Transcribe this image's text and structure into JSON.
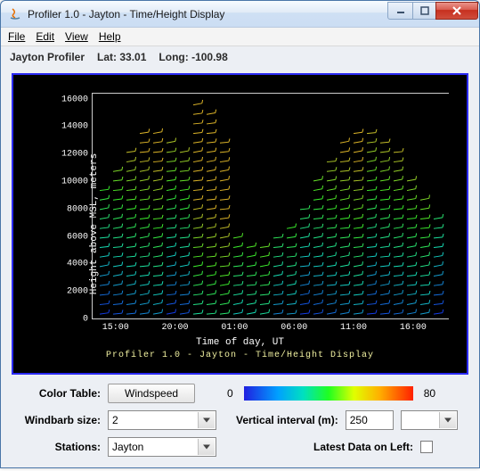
{
  "window": {
    "title": "Profiler 1.0 - Jayton - Time/Height Display"
  },
  "menu": {
    "file": "File",
    "edit": "Edit",
    "view": "View",
    "help": "Help"
  },
  "info": {
    "profiler": "Jayton Profiler",
    "lat_label": "Lat:",
    "lat_value": "33.01",
    "long_label": "Long:",
    "long_value": "-100.98"
  },
  "chart_data": {
    "type": "windbarb-time-height",
    "xlabel": "Time of day, UT",
    "ylabel": "Height above MSL, meters",
    "caption": "Profiler 1.0 - Jayton - Time/Height Display",
    "x_ticks": [
      "15:00",
      "20:00",
      "01:00",
      "06:00",
      "11:00",
      "16:00"
    ],
    "y_ticks": [
      0,
      2000,
      4000,
      6000,
      8000,
      10000,
      12000,
      14000,
      16000
    ],
    "ylim": [
      0,
      16500
    ],
    "color_scale": {
      "variable": "Windspeed",
      "min": 0,
      "max": 80
    }
  },
  "controls": {
    "color_table_label": "Color Table:",
    "color_table_button": "Windspeed",
    "color_min": "0",
    "color_max": "80",
    "windbarb_label": "Windbarb size:",
    "windbarb_value": "2",
    "vinterval_label": "Vertical interval (m):",
    "vinterval_value": "250",
    "stations_label": "Stations:",
    "stations_value": "Jayton",
    "latest_left_label": "Latest Data on Left:",
    "latest_left_checked": false
  }
}
